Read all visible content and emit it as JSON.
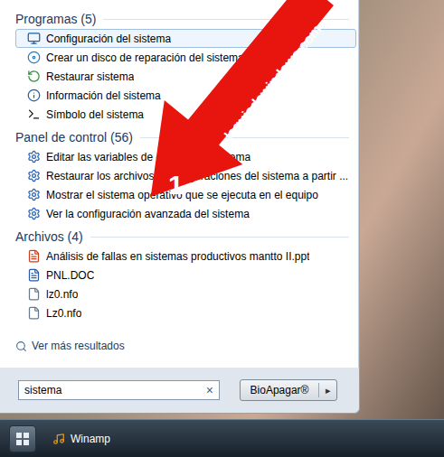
{
  "sections": [
    {
      "title": "Programas (5)",
      "items": [
        {
          "label": "Configuración del sistema",
          "selected": true
        },
        {
          "label": "Crear un disco de reparación del sistema",
          "selected": false
        },
        {
          "label": "Restaurar sistema",
          "selected": false
        },
        {
          "label": "Información del sistema",
          "selected": false
        },
        {
          "label": "Símbolo del sistema",
          "selected": false
        }
      ]
    },
    {
      "title": "Panel de control (56)",
      "items": [
        {
          "label": "Editar las variables de entorno del sistema",
          "selected": false
        },
        {
          "label": "Restaurar los archivos y configuraciones del sistema a partir ...",
          "selected": false
        },
        {
          "label": "Mostrar el sistema operativo que se ejecuta en el equipo",
          "selected": false
        },
        {
          "label": "Ver la configuración avanzada del sistema",
          "selected": false
        }
      ]
    },
    {
      "title": "Archivos (4)",
      "items": [
        {
          "label": "Análisis de fallas en sistemas productivos mantto II.ppt",
          "selected": false
        },
        {
          "label": "PNL.DOC",
          "selected": false
        },
        {
          "label": "lz0.nfo",
          "selected": false
        },
        {
          "label": "Lz0.nfo",
          "selected": false
        }
      ]
    }
  ],
  "more_results": "Ver más resultados",
  "search": {
    "value": "sistema",
    "clear": "×"
  },
  "shutdown_button": {
    "label": "BioApagar®",
    "arrow": "▸"
  },
  "taskbar": {
    "items": [
      {
        "label": "Winamp"
      }
    ]
  },
  "annotation": {
    "number": "1",
    "watermark": "laguiadewindows.com"
  }
}
